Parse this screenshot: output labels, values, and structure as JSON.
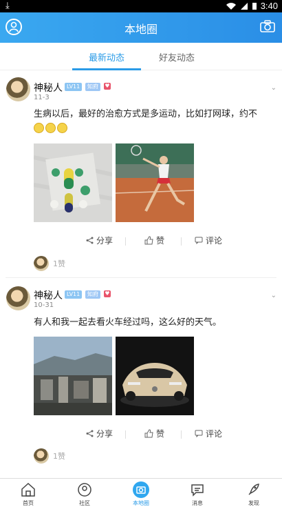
{
  "status_bar": {
    "time": "3:40",
    "download_icon": "download-icon"
  },
  "header": {
    "title": "本地圈"
  },
  "tabs": [
    {
      "label": "最新动态"
    },
    {
      "label": "好友动态"
    }
  ],
  "posts": [
    {
      "name": "神秘人",
      "level": "LV11",
      "badge": "知府",
      "date": "11-3",
      "text": "生病以后，最好的治愈方式是多运动，比如打网球，约不",
      "emoji_count": 3,
      "actions": {
        "share": "分享",
        "like": "赞",
        "comment": "评论"
      },
      "likes": "1赞"
    },
    {
      "name": "神秘人",
      "level": "LV11",
      "badge": "知府",
      "date": "10-31",
      "text": "有人和我一起去看火车经过吗，这么好的天气。",
      "actions": {
        "share": "分享",
        "like": "赞",
        "comment": "评论"
      },
      "likes": "1赞"
    }
  ],
  "bottom_nav": [
    {
      "label": "首页",
      "icon": "home-icon"
    },
    {
      "label": "社区",
      "icon": "community-icon"
    },
    {
      "label": "本地圈",
      "icon": "local-circle-icon"
    },
    {
      "label": "消息",
      "icon": "message-icon"
    },
    {
      "label": "发现",
      "icon": "discover-icon"
    }
  ],
  "colors": {
    "accent": "#2a9be7",
    "header": "#2a8ee6"
  }
}
